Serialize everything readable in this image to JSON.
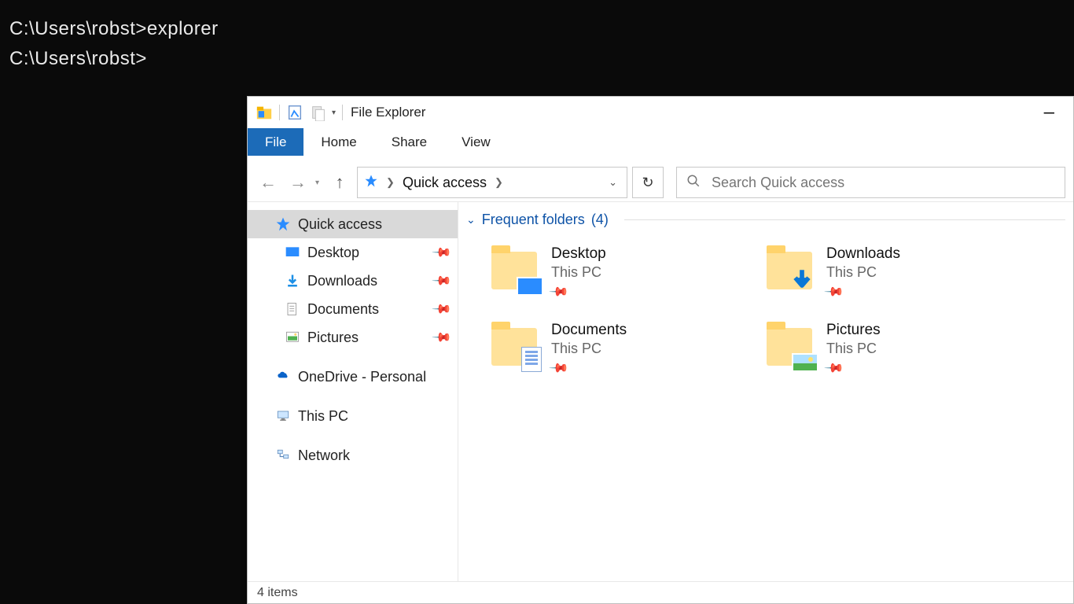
{
  "terminal": {
    "line1": "C:\\Users\\robst>explorer",
    "line2": "",
    "line3": "C:\\Users\\robst>"
  },
  "titlebar": {
    "title": "File Explorer"
  },
  "ribbon": {
    "file": "File",
    "home": "Home",
    "share": "Share",
    "view": "View"
  },
  "address": {
    "crumb": "Quick access"
  },
  "search": {
    "placeholder": "Search Quick access"
  },
  "sidebar": {
    "quick_access": "Quick access",
    "items": [
      {
        "label": "Desktop"
      },
      {
        "label": "Downloads"
      },
      {
        "label": "Documents"
      },
      {
        "label": "Pictures"
      }
    ],
    "onedrive": "OneDrive - Personal",
    "thispc": "This PC",
    "network": "Network"
  },
  "section": {
    "title_prefix": "Frequent folders",
    "count": "(4)"
  },
  "tiles": [
    {
      "name": "Desktop",
      "sub": "This PC"
    },
    {
      "name": "Downloads",
      "sub": "This PC"
    },
    {
      "name": "Documents",
      "sub": "This PC"
    },
    {
      "name": "Pictures",
      "sub": "This PC"
    }
  ],
  "status": {
    "text": "4 items"
  }
}
